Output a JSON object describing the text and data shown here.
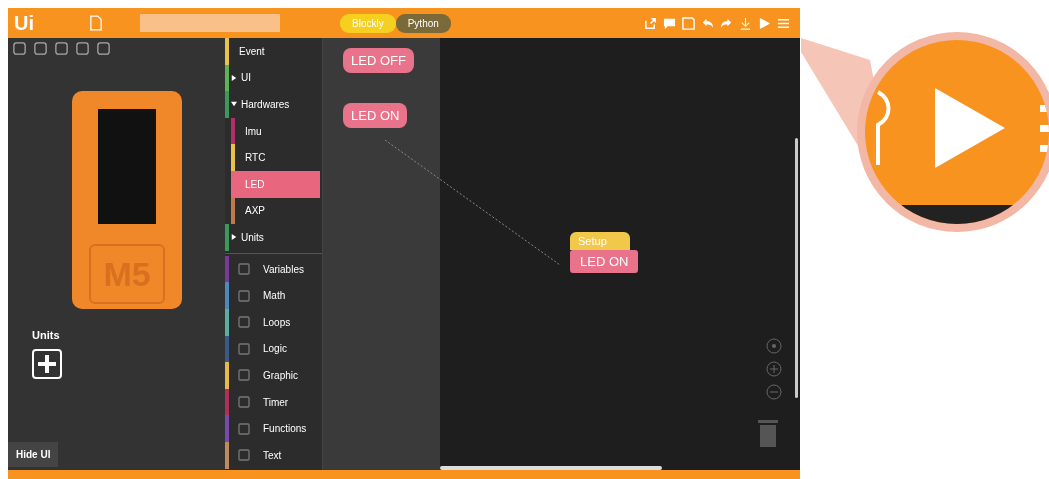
{
  "topbar": {
    "logo": "Ui",
    "mode_tabs": [
      {
        "label": "Blockly",
        "selected": true
      },
      {
        "label": "Python",
        "selected": false
      }
    ]
  },
  "device": {
    "label": "M5"
  },
  "units": {
    "label": "Units"
  },
  "hide_button": "Hide UI",
  "categories": [
    {
      "label": "Event",
      "kind": "item",
      "color": "#e8c24a",
      "selected": false
    },
    {
      "label": "UI",
      "kind": "folder",
      "color": "#5ab552",
      "expanded": false,
      "selected": false
    },
    {
      "label": "Hardwares",
      "kind": "folder",
      "color": "#3a9a5a",
      "expanded": true,
      "selected": false,
      "children": [
        {
          "label": "Imu",
          "kind": "item",
          "color": "#b0306a",
          "selected": false
        },
        {
          "label": "RTC",
          "kind": "item",
          "color": "#e8c24a",
          "selected": false
        },
        {
          "label": "LED",
          "kind": "item",
          "color": "#e8667e",
          "selected": true
        },
        {
          "label": "AXP",
          "kind": "item",
          "color": "#c07a4a",
          "selected": false
        }
      ]
    },
    {
      "label": "Units",
      "kind": "folder",
      "color": "#3a9a5a",
      "expanded": false,
      "selected": false
    },
    {
      "label": "Variables",
      "kind": "tool",
      "color": "#7a3a9a",
      "selected": false
    },
    {
      "label": "Math",
      "kind": "tool",
      "color": "#4a8ac0",
      "selected": false
    },
    {
      "label": "Loops",
      "kind": "tool",
      "color": "#5ab0a0",
      "selected": false
    },
    {
      "label": "Logic",
      "kind": "tool",
      "color": "#3a5a8a",
      "selected": false
    },
    {
      "label": "Graphic",
      "kind": "tool",
      "color": "#e8b84a",
      "selected": false
    },
    {
      "label": "Timer",
      "kind": "tool",
      "color": "#b0305a",
      "selected": false
    },
    {
      "label": "Functions",
      "kind": "tool",
      "color": "#7a4ab0",
      "selected": false
    },
    {
      "label": "Text",
      "kind": "tool",
      "color": "#c08a5a",
      "selected": false
    }
  ],
  "flyout_blocks": [
    {
      "label": "LED OFF"
    },
    {
      "label": "LED ON"
    }
  ],
  "workspace_blocks": [
    {
      "label": "Setup",
      "kind": "event"
    },
    {
      "label": "LED ON",
      "kind": "action"
    }
  ]
}
